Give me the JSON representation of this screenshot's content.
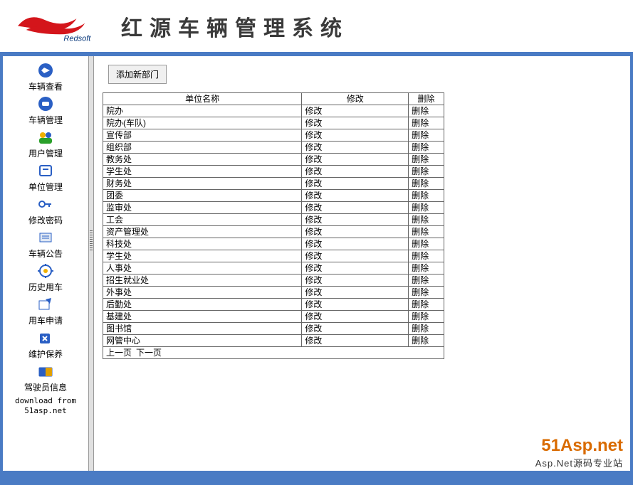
{
  "header": {
    "logo_text": "Redsoft",
    "title": "红源车辆管理系统"
  },
  "sidebar": {
    "items": [
      {
        "label": "车辆查看",
        "icon": "car-view"
      },
      {
        "label": "车辆管理",
        "icon": "car-mgmt"
      },
      {
        "label": "用户管理",
        "icon": "users"
      },
      {
        "label": "单位管理",
        "icon": "org"
      },
      {
        "label": "修改密码",
        "icon": "key"
      },
      {
        "label": "车辆公告",
        "icon": "notice"
      },
      {
        "label": "历史用车",
        "icon": "history"
      },
      {
        "label": "用车申请",
        "icon": "apply"
      },
      {
        "label": "维护保养",
        "icon": "maintain"
      },
      {
        "label": "驾驶员信息",
        "icon": "driver"
      }
    ],
    "download_line1": "download from",
    "download_line2": "51asp.net"
  },
  "content": {
    "add_button": "添加新部门",
    "columns": {
      "name": "单位名称",
      "edit": "修改",
      "del": "删除"
    },
    "edit_label": "修改",
    "del_label": "删除",
    "rows": [
      "院办",
      "院办(车队)",
      "宣传部",
      "组织部",
      "教务处",
      "学生处",
      "财务处",
      "团委",
      "监审处",
      "工会",
      "资产管理处",
      "科技处",
      "学生处",
      "人事处",
      "招生就业处",
      "外事处",
      "后勤处",
      "基建处",
      "图书馆",
      "网管中心"
    ],
    "pager": {
      "prev": "上一页",
      "next": "下一页"
    }
  },
  "footer_brand": {
    "big": "51Asp.net",
    "sub": "Asp.Net源码专业站"
  }
}
